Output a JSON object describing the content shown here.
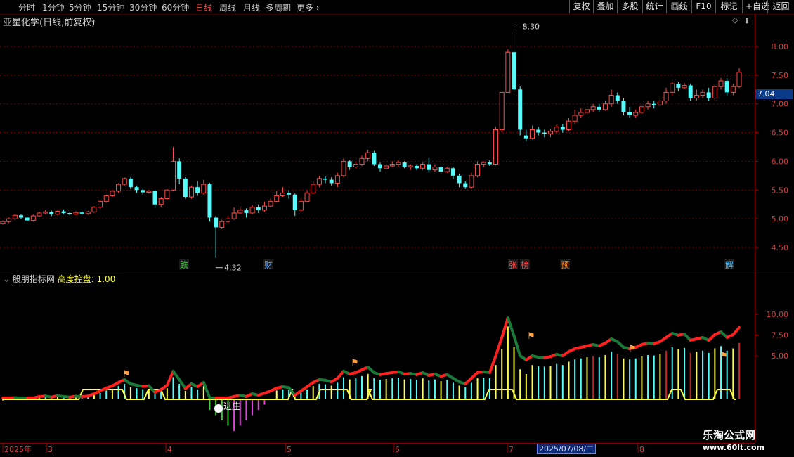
{
  "toolbar": {
    "periods": [
      "分时",
      "1分钟",
      "5分钟",
      "15分钟",
      "30分钟",
      "60分钟",
      "日线",
      "周线",
      "月线",
      "多周期",
      "更多"
    ],
    "active_period": "日线",
    "right_buttons": [
      "复权",
      "叠加",
      "多股",
      "统计",
      "画线",
      "F10",
      "标记",
      "+自选",
      "返回"
    ]
  },
  "stock": {
    "title": "亚星化学(日线,前复权)"
  },
  "price_panel": {
    "axis_labels": [
      "8.00",
      "7.50",
      "7.00",
      "6.50",
      "6.00",
      "5.50",
      "5.00",
      "4.50"
    ],
    "axis_values": [
      8.0,
      7.5,
      7.0,
      6.5,
      6.0,
      5.5,
      5.0,
      4.5
    ],
    "current_price": "7.04",
    "high_label": "8.30",
    "low_label": "4.32",
    "event_markers": [
      {
        "text": "跌",
        "color": "#3ad13a"
      },
      {
        "text": "财",
        "color": "#5aa0ff"
      },
      {
        "text": "张",
        "color": "#ff4040"
      },
      {
        "text": "榜",
        "color": "#ff4040"
      },
      {
        "text": "预",
        "color": "#ff8c1a"
      },
      {
        "text": "解",
        "color": "#40c0ff"
      }
    ]
  },
  "indicator_panel": {
    "name": "股朋指标网",
    "param_label": "高度控盘:",
    "param_value": "1.00",
    "axis_labels": [
      "10.00",
      "7.50",
      "5.00"
    ],
    "axis_values": [
      10.0,
      7.5,
      5.0
    ],
    "annotation": "进庄"
  },
  "time_axis": {
    "labels": [
      "2025年",
      "3",
      "4",
      "5",
      "6",
      "7",
      "8"
    ],
    "selected_date": "2025/07/08/二"
  },
  "watermark": {
    "line1": "乐淘公式网",
    "line2": "www.60lt.com"
  },
  "colors": {
    "up": "#ff4a4a",
    "down": "#54fcfc",
    "grid": "#7a0000",
    "yellow": "#ffff40",
    "green": "#1a7a3a",
    "magenta": "#e040e0"
  },
  "chart_data": {
    "type": "candlestick",
    "ylim": [
      4.3,
      8.4
    ],
    "candles": [
      [
        4.92,
        4.95,
        4.9,
        4.97
      ],
      [
        4.95,
        5.0,
        4.93,
        5.02
      ],
      [
        5.0,
        5.06,
        4.98,
        5.08
      ],
      [
        5.06,
        5.02,
        5.0,
        5.08
      ],
      [
        5.02,
        4.97,
        4.95,
        5.04
      ],
      [
        4.97,
        5.05,
        4.95,
        5.07
      ],
      [
        5.05,
        5.1,
        5.03,
        5.12
      ],
      [
        5.1,
        5.12,
        5.08,
        5.15
      ],
      [
        5.12,
        5.08,
        5.05,
        5.14
      ],
      [
        5.08,
        5.13,
        5.06,
        5.15
      ],
      [
        5.13,
        5.1,
        5.08,
        5.16
      ],
      [
        5.1,
        5.08,
        5.06,
        5.12
      ],
      [
        5.08,
        5.11,
        5.06,
        5.13
      ],
      [
        5.11,
        5.09,
        5.07,
        5.13
      ],
      [
        5.09,
        5.12,
        5.07,
        5.14
      ],
      [
        5.12,
        5.2,
        5.1,
        5.22
      ],
      [
        5.2,
        5.3,
        5.18,
        5.32
      ],
      [
        5.3,
        5.4,
        5.28,
        5.42
      ],
      [
        5.4,
        5.48,
        5.38,
        5.5
      ],
      [
        5.48,
        5.6,
        5.45,
        5.62
      ],
      [
        5.6,
        5.7,
        5.58,
        5.72
      ],
      [
        5.7,
        5.55,
        5.52,
        5.72
      ],
      [
        5.55,
        5.5,
        5.45,
        5.58
      ],
      [
        5.5,
        5.46,
        5.42,
        5.52
      ],
      [
        5.46,
        5.48,
        5.44,
        5.5
      ],
      [
        5.48,
        5.25,
        5.2,
        5.5
      ],
      [
        5.25,
        5.35,
        5.2,
        5.38
      ],
      [
        5.35,
        5.5,
        5.32,
        5.52
      ],
      [
        5.5,
        6.0,
        5.48,
        6.25
      ],
      [
        6.0,
        5.7,
        5.6,
        6.05
      ],
      [
        5.7,
        5.38,
        5.35,
        5.72
      ],
      [
        5.38,
        5.55,
        5.35,
        5.58
      ],
      [
        5.55,
        5.45,
        5.4,
        5.65
      ],
      [
        5.45,
        5.6,
        5.42,
        5.68
      ],
      [
        5.6,
        5.02,
        4.95,
        5.62
      ],
      [
        5.02,
        4.85,
        4.32,
        5.05
      ],
      [
        4.85,
        4.95,
        4.82,
        4.98
      ],
      [
        4.95,
        5.0,
        4.92,
        5.05
      ],
      [
        5.0,
        5.1,
        4.98,
        5.2
      ],
      [
        5.1,
        5.15,
        5.08,
        5.22
      ],
      [
        5.15,
        5.1,
        5.02,
        5.18
      ],
      [
        5.1,
        5.2,
        5.08,
        5.24
      ],
      [
        5.2,
        5.15,
        5.1,
        5.25
      ],
      [
        5.15,
        5.22,
        5.12,
        5.3
      ],
      [
        5.22,
        5.3,
        5.2,
        5.35
      ],
      [
        5.3,
        5.4,
        5.28,
        5.48
      ],
      [
        5.4,
        5.45,
        5.38,
        5.55
      ],
      [
        5.45,
        5.42,
        5.35,
        5.5
      ],
      [
        5.42,
        5.15,
        5.05,
        5.44
      ],
      [
        5.15,
        5.3,
        5.12,
        5.35
      ],
      [
        5.3,
        5.45,
        5.28,
        5.5
      ],
      [
        5.45,
        5.6,
        5.42,
        5.65
      ],
      [
        5.6,
        5.7,
        5.55,
        5.75
      ],
      [
        5.7,
        5.68,
        5.62,
        5.75
      ],
      [
        5.68,
        5.62,
        5.58,
        5.72
      ],
      [
        5.62,
        5.75,
        5.55,
        5.8
      ],
      [
        5.75,
        6.0,
        5.72,
        6.05
      ],
      [
        6.0,
        5.9,
        5.85,
        6.02
      ],
      [
        5.9,
        5.95,
        5.88,
        6.0
      ],
      [
        5.95,
        6.05,
        5.92,
        6.1
      ],
      [
        6.05,
        6.15,
        6.0,
        6.2
      ],
      [
        6.15,
        5.95,
        5.92,
        6.18
      ],
      [
        5.95,
        5.88,
        5.82,
        5.98
      ],
      [
        5.88,
        5.92,
        5.85,
        5.95
      ],
      [
        5.92,
        5.95,
        5.9,
        6.0
      ],
      [
        5.95,
        5.98,
        5.9,
        6.02
      ],
      [
        5.98,
        5.9,
        5.88,
        6.0
      ],
      [
        5.9,
        5.92,
        5.85,
        5.95
      ],
      [
        5.92,
        5.88,
        5.85,
        5.95
      ],
      [
        5.88,
        5.95,
        5.85,
        5.98
      ],
      [
        5.95,
        5.85,
        5.8,
        6.05
      ],
      [
        5.85,
        5.9,
        5.82,
        5.95
      ],
      [
        5.9,
        5.82,
        5.78,
        5.92
      ],
      [
        5.82,
        5.88,
        5.8,
        5.9
      ],
      [
        5.88,
        5.75,
        5.7,
        5.9
      ],
      [
        5.75,
        5.62,
        5.55,
        5.78
      ],
      [
        5.62,
        5.55,
        5.52,
        5.65
      ],
      [
        5.55,
        5.75,
        5.52,
        5.8
      ],
      [
        5.75,
        5.95,
        5.72,
        6.0
      ],
      [
        5.95,
        5.98,
        5.9,
        6.0
      ],
      [
        5.98,
        5.95,
        5.92,
        6.02
      ],
      [
        5.95,
        6.55,
        5.93,
        6.6
      ],
      [
        6.55,
        7.2,
        6.5,
        7.2
      ],
      [
        7.2,
        7.9,
        7.2,
        7.95
      ],
      [
        7.9,
        7.25,
        7.2,
        8.3
      ],
      [
        7.25,
        6.55,
        6.45,
        7.3
      ],
      [
        6.45,
        6.4,
        6.35,
        6.55
      ],
      [
        6.4,
        6.55,
        6.38,
        6.62
      ],
      [
        6.55,
        6.5,
        6.45,
        6.6
      ],
      [
        6.5,
        6.48,
        6.42,
        6.55
      ],
      [
        6.48,
        6.52,
        6.42,
        6.56
      ],
      [
        6.52,
        6.6,
        6.48,
        6.65
      ],
      [
        6.6,
        6.55,
        6.5,
        6.65
      ],
      [
        6.55,
        6.7,
        6.52,
        6.75
      ],
      [
        6.7,
        6.8,
        6.65,
        6.9
      ],
      [
        6.8,
        6.85,
        6.75,
        6.92
      ],
      [
        6.85,
        6.9,
        6.8,
        6.95
      ],
      [
        6.9,
        6.95,
        6.85,
        7.0
      ],
      [
        6.95,
        6.9,
        6.85,
        7.0
      ],
      [
        6.9,
        7.0,
        6.88,
        7.05
      ],
      [
        7.0,
        7.15,
        6.95,
        7.25
      ],
      [
        7.15,
        7.05,
        7.0,
        7.2
      ],
      [
        7.05,
        6.85,
        6.8,
        7.1
      ],
      [
        6.85,
        6.8,
        6.75,
        6.95
      ],
      [
        6.8,
        6.85,
        6.75,
        6.9
      ],
      [
        6.85,
        6.95,
        6.82,
        7.0
      ],
      [
        6.95,
        7.0,
        6.9,
        7.05
      ],
      [
        7.0,
        6.98,
        6.92,
        7.05
      ],
      [
        6.98,
        7.05,
        6.95,
        7.1
      ],
      [
        7.05,
        7.2,
        7.0,
        7.28
      ],
      [
        7.2,
        7.35,
        7.15,
        7.38
      ],
      [
        7.35,
        7.28,
        7.22,
        7.38
      ],
      [
        7.28,
        7.32,
        7.25,
        7.36
      ],
      [
        7.32,
        7.1,
        7.05,
        7.35
      ],
      [
        7.1,
        7.15,
        7.05,
        7.25
      ],
      [
        7.15,
        7.2,
        7.1,
        7.25
      ],
      [
        7.2,
        7.1,
        7.05,
        7.28
      ],
      [
        7.1,
        7.3,
        7.05,
        7.35
      ],
      [
        7.3,
        7.4,
        7.25,
        7.45
      ],
      [
        7.4,
        7.2,
        7.15,
        7.45
      ],
      [
        7.2,
        7.3,
        7.15,
        7.35
      ],
      [
        7.3,
        7.55,
        7.28,
        7.62
      ]
    ]
  }
}
